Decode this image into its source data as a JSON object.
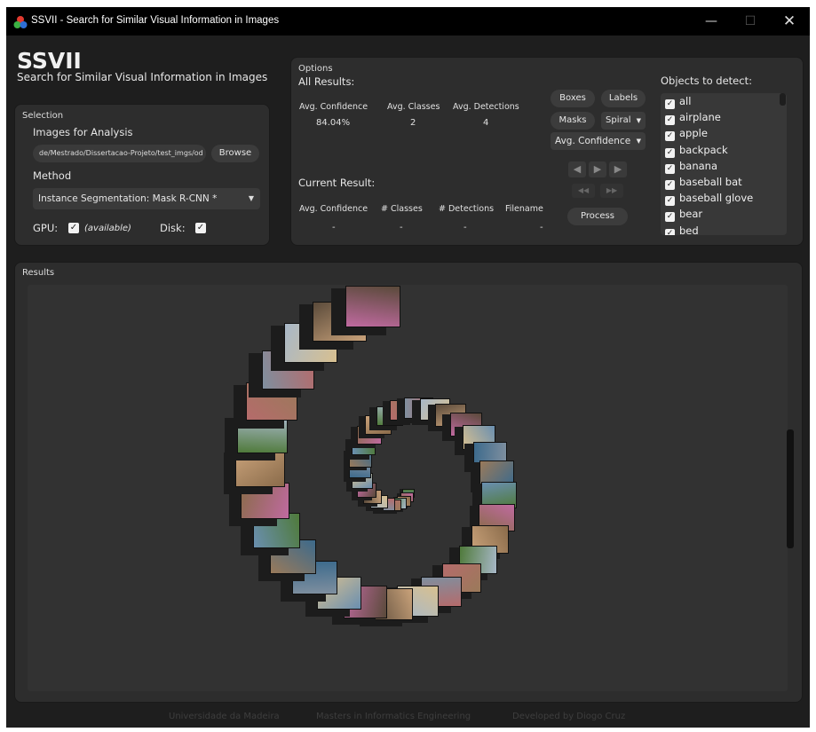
{
  "window": {
    "title": "SSVII - Search for Similar Visual Information in Images"
  },
  "header": {
    "title": "SSVII",
    "subtitle": "Search for Similar Visual Information in Images"
  },
  "selection": {
    "section_label": "Selection",
    "images_label": "Images for Analysis",
    "path_value": "de/Mestrado/Dissertacao-Projeto/test_imgs/od",
    "browse_label": "Browse",
    "method_label": "Method",
    "method_value": "Instance Segmentation:  Mask R-CNN *",
    "gpu_label": "GPU:",
    "gpu_status": "(available)",
    "gpu_checked": true,
    "disk_label": "Disk:",
    "disk_checked": true
  },
  "options": {
    "section_label": "Options",
    "all_results_label": "All Results:",
    "all_headers": {
      "confidence": "Avg. Confidence",
      "classes": "Avg. Classes",
      "detections": "Avg. Detections"
    },
    "all_values": {
      "confidence": "84.04%",
      "classes": "2",
      "detections": "4"
    },
    "current_result_label": "Current Result:",
    "current_headers": {
      "confidence": "Avg. Confidence",
      "classes": "# Classes",
      "detections": "# Detections",
      "filename": "Filename"
    },
    "current_values": {
      "confidence": "-",
      "classes": "-",
      "detections": "-",
      "filename": "-"
    },
    "boxes_label": "Boxes",
    "labels_label": "Labels",
    "masks_label": "Masks",
    "layout_value": "Spiral",
    "sort_value": "Avg. Confidence",
    "process_label": "Process"
  },
  "objects": {
    "title": "Objects to detect:",
    "items": [
      "all",
      "airplane",
      "apple",
      "backpack",
      "banana",
      "baseball bat",
      "baseball glove",
      "bear",
      "bed"
    ]
  },
  "results": {
    "section_label": "Results",
    "thumbnail_count": 45
  },
  "footer": {
    "university": "Universidade da Madeira",
    "program": "Masters in Informatics Engineering",
    "author": "Developed by Diogo Cruz"
  },
  "colors": {
    "window_bg": "#1e1e1e",
    "panel_bg": "#2d2d2d",
    "canvas_bg": "#323232",
    "titlebar_bg": "#000000"
  }
}
